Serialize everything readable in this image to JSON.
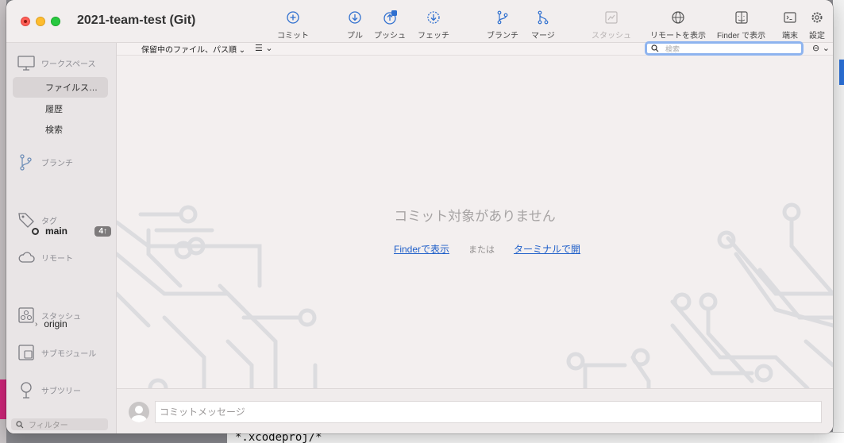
{
  "window": {
    "title": "2021-team-test (Git)"
  },
  "toolbar": {
    "commit": "コミット",
    "pull": "プル",
    "push": "プッシュ",
    "fetch": "フェッチ",
    "branch": "ブランチ",
    "merge": "マージ",
    "stash": "スタッシュ",
    "show_remote": "リモートを表示",
    "show_finder": "Finder で表示",
    "terminal": "端末",
    "settings": "設定"
  },
  "sidebar": {
    "workspace": {
      "heading": "ワークスペース",
      "items": [
        {
          "label": "ファイルス…",
          "selected": true
        },
        {
          "label": "履歴",
          "selected": false
        },
        {
          "label": "検索",
          "selected": false
        }
      ]
    },
    "branches": {
      "heading": "ブランチ",
      "current": "main",
      "badge": "4↑"
    },
    "tags": {
      "heading": "タグ"
    },
    "remotes": {
      "heading": "リモート",
      "items": [
        "origin"
      ]
    },
    "stashes": {
      "heading": "スタッシュ"
    },
    "submodules": {
      "heading": "サブモジュール"
    },
    "subtrees": {
      "heading": "サブツリー"
    },
    "filter_placeholder": "フィルター"
  },
  "filterbar": {
    "sort_label": "保留中のファイル、パス順",
    "search_placeholder": "検索"
  },
  "main": {
    "empty_message": "コミット対象がありません",
    "show_finder_link": "Finderで表示",
    "or_text": "または",
    "terminal_link": "ターミナルで開"
  },
  "commit": {
    "placeholder": "コミットメッセージ"
  },
  "desktop": {
    "bottom_text": "*.xcodeproj/*"
  },
  "colors": {
    "accent": "#1f5fc9",
    "tool_icon": "#2f6fcf"
  }
}
